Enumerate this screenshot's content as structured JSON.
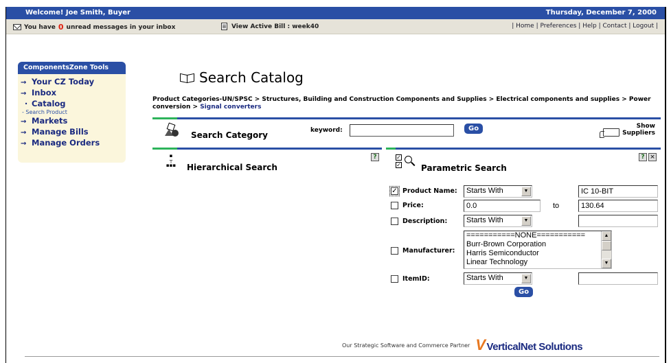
{
  "topbar": {
    "welcome": "Welcome! Joe Smith, Buyer",
    "date": "Thursday, December 7, 2000"
  },
  "subbar": {
    "msg_prefix": "You have",
    "unread_count": "0",
    "msg_suffix": "unread messages in your inbox",
    "bill": "View Active Bill : week40",
    "links": [
      "| Home",
      "| Preferences",
      "| Help",
      "| Contact",
      "| Logout |"
    ]
  },
  "sidebar": {
    "title": "ComponentsZone Tools",
    "items": [
      {
        "label": "Your CZ Today"
      },
      {
        "label": "Inbox"
      },
      {
        "label": "Catalog"
      },
      {
        "label": "- Search Product"
      },
      {
        "label": "Markets"
      },
      {
        "label": "Manage Bills"
      },
      {
        "label": "Manage Orders"
      }
    ]
  },
  "main": {
    "title": "Search Catalog",
    "breadcrumb": {
      "path": "Product Categories-UN/SPSC  > Structures, Building and Construction Components and Supplies  > Electrical components and supplies  > Power conversion  > ",
      "current": "Signal converters"
    },
    "search_category": {
      "label": "Search Category",
      "keyword_label": "keyword:",
      "keyword_value": "",
      "go": "Go",
      "show_suppliers_line1": "Show",
      "show_suppliers_line2": "Suppliers"
    },
    "hierarchical": {
      "label": "Hierarchical Search",
      "help": "?"
    },
    "parametric": {
      "label": "Parametric Search",
      "help": "?",
      "close": "×",
      "product_name": {
        "label": "Product Name:",
        "checked": true,
        "mode": "Starts With",
        "value": "IC 10-BIT"
      },
      "price": {
        "label": "Price:",
        "from": "0.0",
        "to_label": "to",
        "to": "130.64"
      },
      "description": {
        "label": "Description:",
        "mode": "Starts With",
        "value": ""
      },
      "manufacturer": {
        "label": "Manufacturer:",
        "options": [
          "===========NONE===========",
          "Burr-Brown Corporation",
          "Harris Semiconductor",
          "Linear Technology"
        ]
      },
      "itemid": {
        "label": "ItemID:",
        "mode": "Starts With",
        "value": ""
      },
      "go": "Go"
    }
  },
  "footer": {
    "partner_text": "Our Strategic Software and Commerce Partner",
    "logo_v": "V",
    "logo_text": "VerticalNet Solutions"
  },
  "colors": {
    "brand_blue": "#2a4fa5",
    "accent_green": "#2db35a",
    "alert_red": "#e02010",
    "logo_orange": "#e87820"
  }
}
